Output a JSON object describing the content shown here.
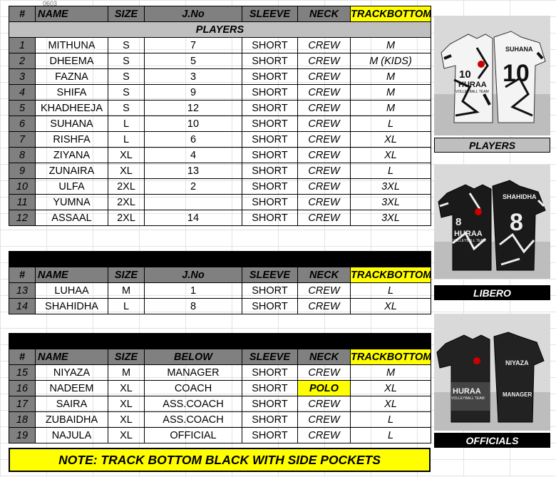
{
  "headers_players": {
    "num": "#",
    "name": "NAME",
    "size": "SIZE",
    "jno": "J.No",
    "sleeve": "SLEEVE",
    "neck": "NECK",
    "track": "TRACKBOTTOM"
  },
  "headers_officials": {
    "num": "#",
    "name": "NAME",
    "size": "SIZE",
    "jno": "BELOW",
    "sleeve": "SLEEVE",
    "neck": "NECK",
    "track": "TRACKBOTTOM"
  },
  "players_title": "PLAYERS",
  "libero_title": "LIBERO",
  "officials_title": "OFFICIALS",
  "players": [
    {
      "num": "1",
      "name": "MITHUNA",
      "size": "S",
      "jno": "7",
      "sleeve": "SHORT",
      "neck": "CREW",
      "track": "M"
    },
    {
      "num": "2",
      "name": "DHEEMA",
      "size": "S",
      "jno": "5",
      "sleeve": "SHORT",
      "neck": "CREW",
      "track": "M (KIDS)"
    },
    {
      "num": "3",
      "name": "FAZNA",
      "size": "S",
      "jno": "3",
      "sleeve": "SHORT",
      "neck": "CREW",
      "track": "M"
    },
    {
      "num": "4",
      "name": "SHIFA",
      "size": "S",
      "jno": "9",
      "sleeve": "SHORT",
      "neck": "CREW",
      "track": "M"
    },
    {
      "num": "5",
      "name": "KHADHEEJA",
      "size": "S",
      "jno": "12",
      "sleeve": "SHORT",
      "neck": "CREW",
      "track": "M"
    },
    {
      "num": "6",
      "name": "SUHANA",
      "size": "L",
      "jno": "10",
      "sleeve": "SHORT",
      "neck": "CREW",
      "track": "L"
    },
    {
      "num": "7",
      "name": "RISHFA",
      "size": "L",
      "jno": "6",
      "sleeve": "SHORT",
      "neck": "CREW",
      "track": "XL"
    },
    {
      "num": "8",
      "name": "ZIYANA",
      "size": "XL",
      "jno": "4",
      "sleeve": "SHORT",
      "neck": "CREW",
      "track": "XL"
    },
    {
      "num": "9",
      "name": "ZUNAIRA",
      "size": "XL",
      "jno": "13",
      "sleeve": "SHORT",
      "neck": "CREW",
      "track": "L"
    },
    {
      "num": "10",
      "name": "ULFA",
      "size": "2XL",
      "jno": "2",
      "sleeve": "SHORT",
      "neck": "CREW",
      "track": "3XL"
    },
    {
      "num": "11",
      "name": "YUMNA",
      "size": "2XL",
      "jno": "",
      "sleeve": "SHORT",
      "neck": "CREW",
      "track": "3XL"
    },
    {
      "num": "12",
      "name": "ASSAAL",
      "size": "2XL",
      "jno": "14",
      "sleeve": "SHORT",
      "neck": "CREW",
      "track": "3XL"
    }
  ],
  "libero": [
    {
      "num": "13",
      "name": "LUHAA",
      "size": "M",
      "jno": "1",
      "sleeve": "SHORT",
      "neck": "CREW",
      "track": "L"
    },
    {
      "num": "14",
      "name": "SHAHIDHA",
      "size": "L",
      "jno": "8",
      "sleeve": "SHORT",
      "neck": "CREW",
      "track": "XL"
    }
  ],
  "officials": [
    {
      "num": "15",
      "name": "NIYAZA",
      "size": "M",
      "jno": "MANAGER",
      "sleeve": "SHORT",
      "neck": "CREW",
      "track": "M"
    },
    {
      "num": "16",
      "name": "NADEEM",
      "size": "XL",
      "jno": "COACH",
      "sleeve": "SHORT",
      "neck": "POLO",
      "track": "XL"
    },
    {
      "num": "17",
      "name": "SAIRA",
      "size": "XL",
      "jno": "ASS.COACH",
      "sleeve": "SHORT",
      "neck": "CREW",
      "track": "XL"
    },
    {
      "num": "18",
      "name": "ZUBAIDHA",
      "size": "XL",
      "jno": "ASS.COACH",
      "sleeve": "SHORT",
      "neck": "CREW",
      "track": "L"
    },
    {
      "num": "19",
      "name": "NAJULA",
      "size": "XL",
      "jno": "OFFICIAL",
      "sleeve": "SHORT",
      "neck": "CREW",
      "track": "L"
    }
  ],
  "note": "NOTE: TRACK BOTTOM BLACK WITH SIDE POCKETS",
  "captions": {
    "players": "PLAYERS",
    "libero": "LIBERO",
    "officials": "OFFICIALS"
  },
  "jersey_labels": {
    "players": {
      "back_name": "SUHANA",
      "front_num": "10",
      "back_num": "10",
      "brand": "HURAA",
      "team": "VOLLEYBALL TEAM"
    },
    "libero": {
      "back_name": "SHAHIDHA",
      "front_num": "8",
      "back_num": "8",
      "brand": "HURAA",
      "team": "VOLLEYBALL TEAM"
    },
    "officials": {
      "back_name": "NIYAZA",
      "back_role": "MANAGER",
      "brand": "HURAA",
      "team": "VOLLEYBALL TEAM"
    }
  },
  "colors": {
    "header_grey": "#808080",
    "highlight_yellow": "#ffff00",
    "section_black": "#000000",
    "caption_grey": "#bfbfbf"
  }
}
